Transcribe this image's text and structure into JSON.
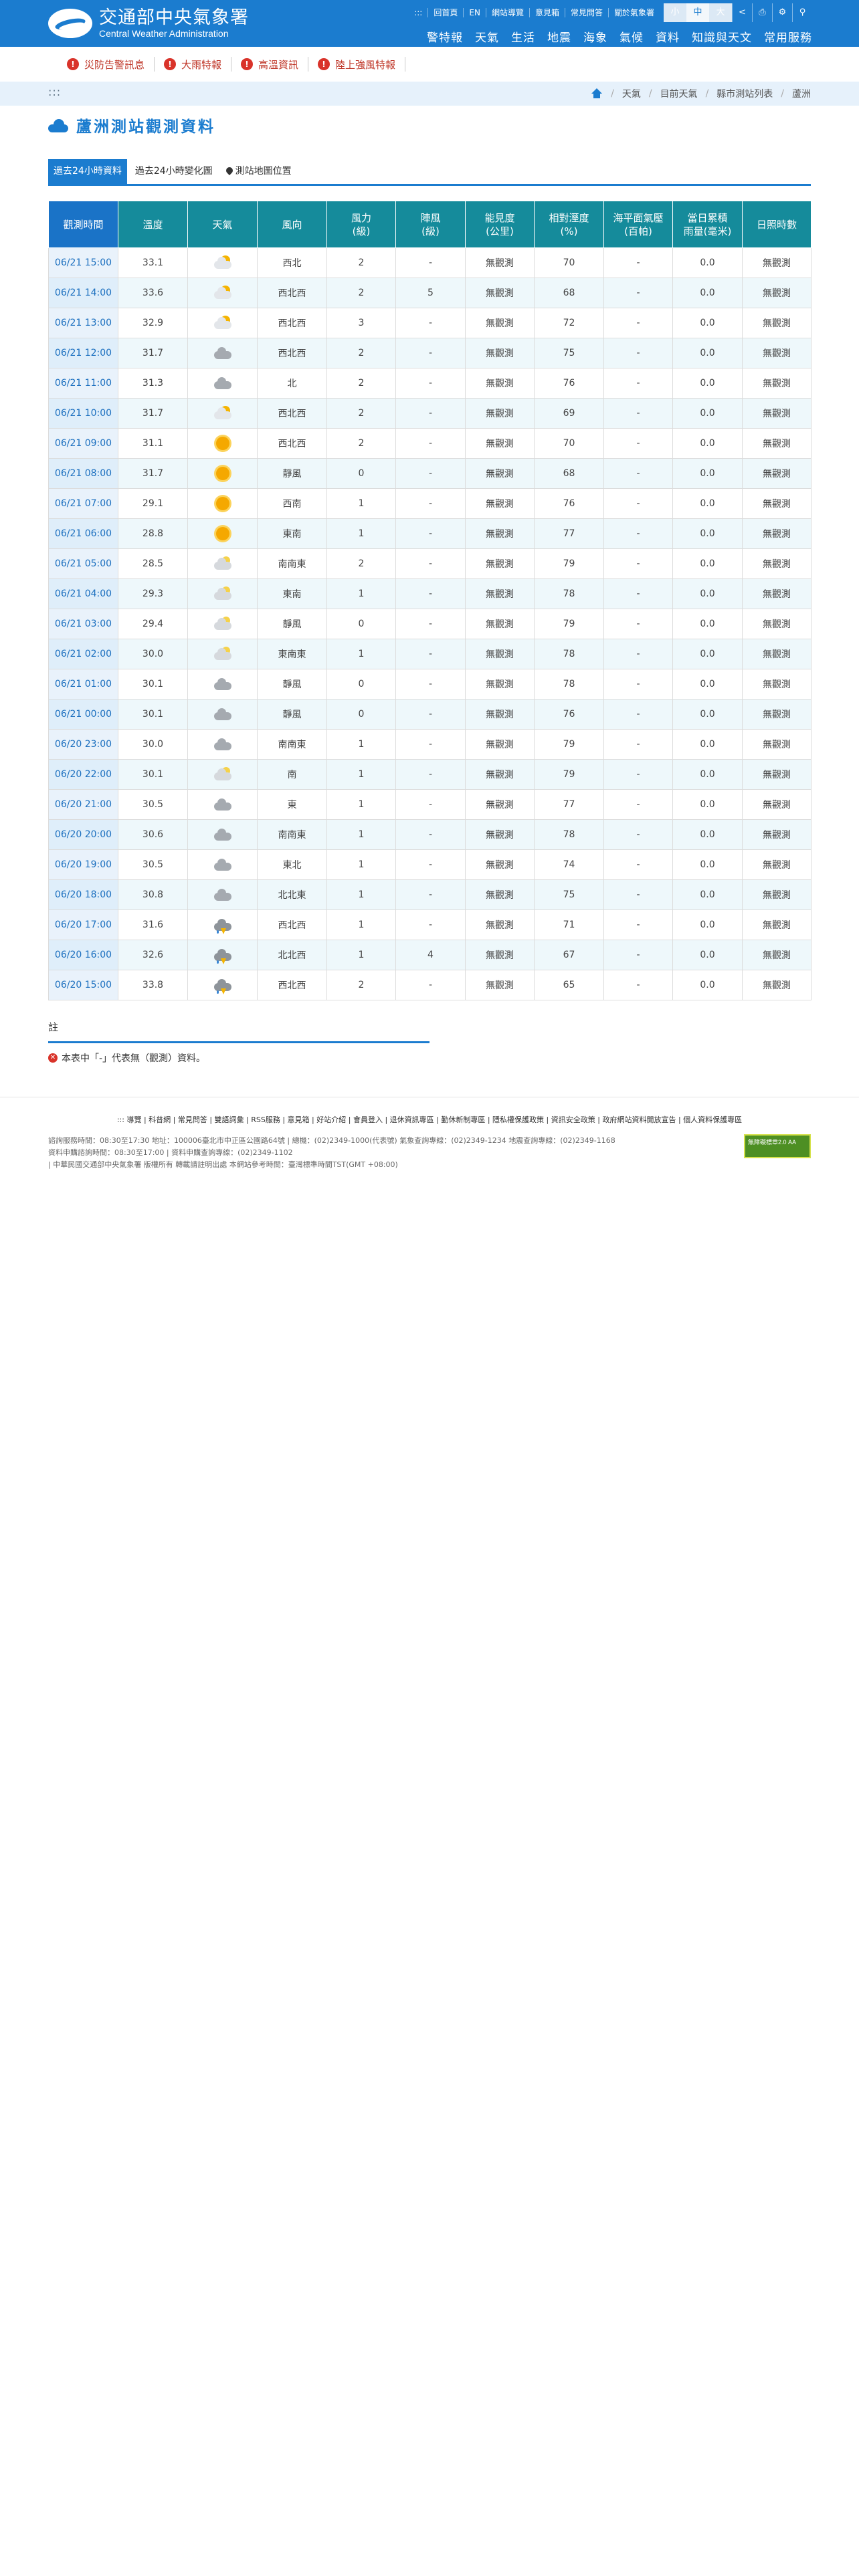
{
  "header": {
    "logo_zh": "交通部中央氣象署",
    "logo_en": "Central Weather Administration",
    "util_links": [
      "::: ",
      "回首頁",
      "EN",
      "網站導覽",
      "意見箱",
      "常見問答",
      "關於氣象署"
    ],
    "font_sizes": [
      "小",
      "中",
      "大"
    ],
    "main_nav": [
      "警特報",
      "天氣",
      "生活",
      "地震",
      "海象",
      "氣候",
      "資料",
      "知識與天文",
      "常用服務"
    ]
  },
  "alerts": [
    "災防告警訊息",
    "大雨特報",
    "高溫資訊",
    "陸上強風特報"
  ],
  "breadcrumb": {
    "menu": ":::",
    "items": [
      "天氣",
      "目前天氣",
      "縣市測站列表",
      "蘆洲"
    ]
  },
  "page": {
    "title": "蘆洲測站觀測資料"
  },
  "tabs": [
    "過去24小時資料",
    "過去24小時變化圖",
    "測站地圖位置"
  ],
  "table": {
    "headers": [
      "觀測時間",
      "溫度",
      "天氣",
      "風向",
      "風力\n(級)",
      "陣風\n(級)",
      "能見度\n(公里)",
      "相對溼度\n(%)",
      "海平面氣壓\n(百帕)",
      "當日累積\n雨量(毫米)",
      "日照時數"
    ],
    "rows": [
      {
        "time": "06/21 15:00",
        "temp": "33.1",
        "wx": "partly",
        "dir": "西北",
        "wind": "2",
        "gust": "-",
        "vis": "無觀測",
        "rh": "70",
        "pres": "-",
        "rain": "0.0",
        "sun": "無觀測"
      },
      {
        "time": "06/21 14:00",
        "temp": "33.6",
        "wx": "partly",
        "dir": "西北西",
        "wind": "2",
        "gust": "5",
        "vis": "無觀測",
        "rh": "68",
        "pres": "-",
        "rain": "0.0",
        "sun": "無觀測"
      },
      {
        "time": "06/21 13:00",
        "temp": "32.9",
        "wx": "partly",
        "dir": "西北西",
        "wind": "3",
        "gust": "-",
        "vis": "無觀測",
        "rh": "72",
        "pres": "-",
        "rain": "0.0",
        "sun": "無觀測"
      },
      {
        "time": "06/21 12:00",
        "temp": "31.7",
        "wx": "cloudy",
        "dir": "西北西",
        "wind": "2",
        "gust": "-",
        "vis": "無觀測",
        "rh": "75",
        "pres": "-",
        "rain": "0.0",
        "sun": "無觀測"
      },
      {
        "time": "06/21 11:00",
        "temp": "31.3",
        "wx": "cloudy",
        "dir": "北",
        "wind": "2",
        "gust": "-",
        "vis": "無觀測",
        "rh": "76",
        "pres": "-",
        "rain": "0.0",
        "sun": "無觀測"
      },
      {
        "time": "06/21 10:00",
        "temp": "31.7",
        "wx": "partly",
        "dir": "西北西",
        "wind": "2",
        "gust": "-",
        "vis": "無觀測",
        "rh": "69",
        "pres": "-",
        "rain": "0.0",
        "sun": "無觀測"
      },
      {
        "time": "06/21 09:00",
        "temp": "31.1",
        "wx": "sunny",
        "dir": "西北西",
        "wind": "2",
        "gust": "-",
        "vis": "無觀測",
        "rh": "70",
        "pres": "-",
        "rain": "0.0",
        "sun": "無觀測"
      },
      {
        "time": "06/21 08:00",
        "temp": "31.7",
        "wx": "sunny",
        "dir": "靜風",
        "wind": "0",
        "gust": "-",
        "vis": "無觀測",
        "rh": "68",
        "pres": "-",
        "rain": "0.0",
        "sun": "無觀測"
      },
      {
        "time": "06/21 07:00",
        "temp": "29.1",
        "wx": "sunny",
        "dir": "西南",
        "wind": "1",
        "gust": "-",
        "vis": "無觀測",
        "rh": "76",
        "pres": "-",
        "rain": "0.0",
        "sun": "無觀測"
      },
      {
        "time": "06/21 06:00",
        "temp": "28.8",
        "wx": "sunny",
        "dir": "東南",
        "wind": "1",
        "gust": "-",
        "vis": "無觀測",
        "rh": "77",
        "pres": "-",
        "rain": "0.0",
        "sun": "無觀測"
      },
      {
        "time": "06/21 05:00",
        "temp": "28.5",
        "wx": "moon",
        "dir": "南南東",
        "wind": "2",
        "gust": "-",
        "vis": "無觀測",
        "rh": "79",
        "pres": "-",
        "rain": "0.0",
        "sun": "無觀測"
      },
      {
        "time": "06/21 04:00",
        "temp": "29.3",
        "wx": "moon",
        "dir": "東南",
        "wind": "1",
        "gust": "-",
        "vis": "無觀測",
        "rh": "78",
        "pres": "-",
        "rain": "0.0",
        "sun": "無觀測"
      },
      {
        "time": "06/21 03:00",
        "temp": "29.4",
        "wx": "moon",
        "dir": "靜風",
        "wind": "0",
        "gust": "-",
        "vis": "無觀測",
        "rh": "79",
        "pres": "-",
        "rain": "0.0",
        "sun": "無觀測"
      },
      {
        "time": "06/21 02:00",
        "temp": "30.0",
        "wx": "moon",
        "dir": "東南東",
        "wind": "1",
        "gust": "-",
        "vis": "無觀測",
        "rh": "78",
        "pres": "-",
        "rain": "0.0",
        "sun": "無觀測"
      },
      {
        "time": "06/21 01:00",
        "temp": "30.1",
        "wx": "cloudy",
        "dir": "靜風",
        "wind": "0",
        "gust": "-",
        "vis": "無觀測",
        "rh": "78",
        "pres": "-",
        "rain": "0.0",
        "sun": "無觀測"
      },
      {
        "time": "06/21 00:00",
        "temp": "30.1",
        "wx": "cloudy",
        "dir": "靜風",
        "wind": "0",
        "gust": "-",
        "vis": "無觀測",
        "rh": "76",
        "pres": "-",
        "rain": "0.0",
        "sun": "無觀測"
      },
      {
        "time": "06/20 23:00",
        "temp": "30.0",
        "wx": "cloudy",
        "dir": "南南東",
        "wind": "1",
        "gust": "-",
        "vis": "無觀測",
        "rh": "79",
        "pres": "-",
        "rain": "0.0",
        "sun": "無觀測"
      },
      {
        "time": "06/20 22:00",
        "temp": "30.1",
        "wx": "moon",
        "dir": "南",
        "wind": "1",
        "gust": "-",
        "vis": "無觀測",
        "rh": "79",
        "pres": "-",
        "rain": "0.0",
        "sun": "無觀測"
      },
      {
        "time": "06/20 21:00",
        "temp": "30.5",
        "wx": "cloudy",
        "dir": "東",
        "wind": "1",
        "gust": "-",
        "vis": "無觀測",
        "rh": "77",
        "pres": "-",
        "rain": "0.0",
        "sun": "無觀測"
      },
      {
        "time": "06/20 20:00",
        "temp": "30.6",
        "wx": "cloudy",
        "dir": "南南東",
        "wind": "1",
        "gust": "-",
        "vis": "無觀測",
        "rh": "78",
        "pres": "-",
        "rain": "0.0",
        "sun": "無觀測"
      },
      {
        "time": "06/20 19:00",
        "temp": "30.5",
        "wx": "cloudy",
        "dir": "東北",
        "wind": "1",
        "gust": "-",
        "vis": "無觀測",
        "rh": "74",
        "pres": "-",
        "rain": "0.0",
        "sun": "無觀測"
      },
      {
        "time": "06/20 18:00",
        "temp": "30.8",
        "wx": "cloudy",
        "dir": "北北東",
        "wind": "1",
        "gust": "-",
        "vis": "無觀測",
        "rh": "75",
        "pres": "-",
        "rain": "0.0",
        "sun": "無觀測"
      },
      {
        "time": "06/20 17:00",
        "temp": "31.6",
        "wx": "thunder",
        "dir": "西北西",
        "wind": "1",
        "gust": "-",
        "vis": "無觀測",
        "rh": "71",
        "pres": "-",
        "rain": "0.0",
        "sun": "無觀測"
      },
      {
        "time": "06/20 16:00",
        "temp": "32.6",
        "wx": "thunder",
        "dir": "北北西",
        "wind": "1",
        "gust": "4",
        "vis": "無觀測",
        "rh": "67",
        "pres": "-",
        "rain": "0.0",
        "sun": "無觀測"
      },
      {
        "time": "06/20 15:00",
        "temp": "33.8",
        "wx": "thunder",
        "dir": "西北西",
        "wind": "2",
        "gust": "-",
        "vis": "無觀測",
        "rh": "65",
        "pres": "-",
        "rain": "0.0",
        "sun": "無觀測"
      }
    ]
  },
  "notes": {
    "title": "註",
    "items": [
      "本表中「-」代表無（觀測）資料。"
    ]
  },
  "footer": {
    "links": "::: 導覽 | 科普網 | 常見問答 | 雙語詞彙 | RSS服務 | 意見箱 | 好站介紹 | 會員登入 | 退休資訊專區 | 勤休新制專區 | 隱私權保護政策 | 資訊安全政策 | 政府網站資料開放宣告 | 個人資料保護專區",
    "info": [
      "諮詢服務時間：08:30至17:30 地址：100006臺北市中正區公園路64號 | 總機：(02)2349-1000(代表號) 氣象查詢專線：(02)2349-1234 地震查詢專線：(02)2349-1168",
      "資料申購諮詢時間：08:30至17:00 | 資料申購查詢專線：(02)2349-1102",
      "| 中華民國交通部中央氣象署 版權所有 轉載請註明出處 本網站參考時間：臺灣標準時間TST(GMT +08:00)"
    ],
    "badge": "無障礙標章2.0 AA"
  },
  "colors": {
    "brand_blue": "#1b7ccf",
    "table_header_teal": "#158b9b",
    "alert_red": "#d9332a"
  }
}
